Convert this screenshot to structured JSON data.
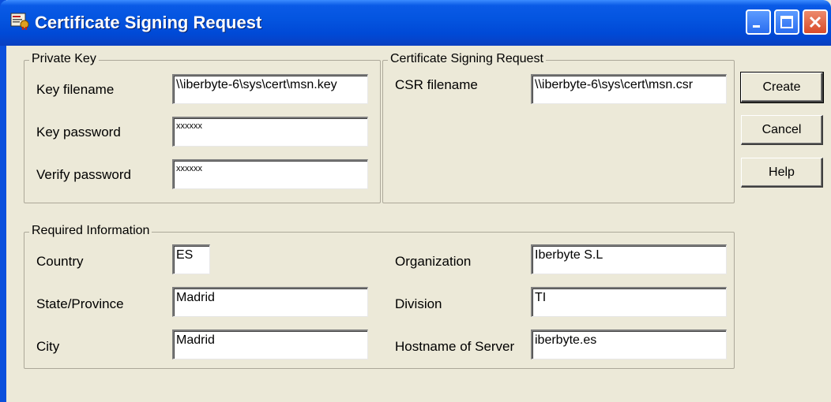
{
  "window": {
    "title": "Certificate Signing Request",
    "icon": "certificate-app-icon"
  },
  "titlebar_buttons": {
    "minimize_icon": "minimize-icon",
    "maximize_icon": "maximize-icon",
    "close_icon": "close-icon"
  },
  "private_key": {
    "legend": "Private Key",
    "key_filename_label": "Key filename",
    "key_filename_value": "\\\\iberbyte-6\\sys\\cert\\msn.key",
    "key_password_label": "Key password",
    "key_password_value": "xxxxxx",
    "verify_password_label": "Verify password",
    "verify_password_value": "xxxxxx"
  },
  "csr": {
    "legend": "Certificate Signing Request",
    "csr_filename_label": "CSR filename",
    "csr_filename_value": "\\\\iberbyte-6\\sys\\cert\\msn.csr"
  },
  "required": {
    "legend": "Required Information",
    "country_label": "Country",
    "country_value": "ES",
    "state_label": "State/Province",
    "state_value": "Madrid",
    "city_label": "City",
    "city_value": "Madrid",
    "organization_label": "Organization",
    "organization_value": "Iberbyte S.L",
    "division_label": "Division",
    "division_value": "TI",
    "hostname_label": "Hostname of Server",
    "hostname_value": "iberbyte.es"
  },
  "buttons": {
    "create": "Create",
    "cancel": "Cancel",
    "help": "Help"
  },
  "colors": {
    "titlebar": "#0455e0",
    "dialog_bg": "#ece9d8",
    "close_button": "#d94b2a"
  }
}
